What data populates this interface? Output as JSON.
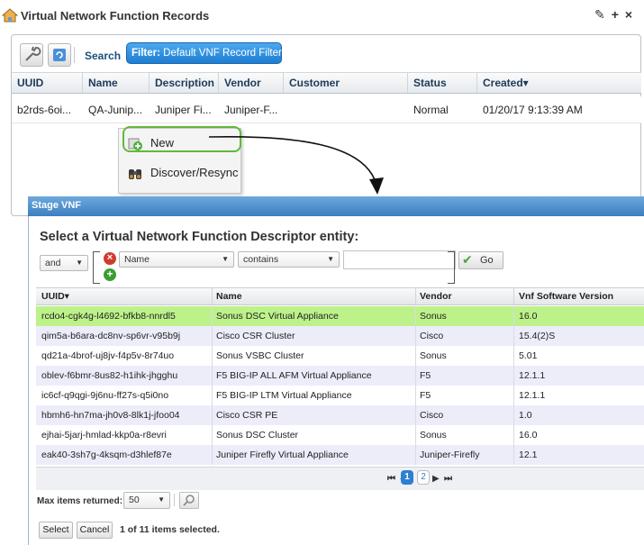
{
  "title": "Virtual Network Function Records",
  "title_actions": [
    "✎",
    "+",
    "×"
  ],
  "toolbar": {
    "search_label": "Search",
    "filter_prefix": "Filter:",
    "filter_value": "Default VNF Record Filter"
  },
  "vnf_table": {
    "columns": [
      "UUID",
      "Name",
      "Description",
      "Vendor",
      "Customer",
      "Status",
      "Created▾"
    ],
    "row": [
      "b2rds-6oi...",
      "QA-Junip...",
      "Juniper Fi...",
      "Juniper-F...",
      "",
      "Normal",
      "01/20/17 9:13:39 AM"
    ]
  },
  "context_menu": {
    "items": [
      {
        "label": "New",
        "icon": "new-icon"
      },
      {
        "label": "Discover/Resync",
        "icon": "binoculars-icon"
      }
    ]
  },
  "dialog": {
    "title": "Stage VNF",
    "heading": "Select a Virtual Network Function Descriptor entity:",
    "filter": {
      "conjunction": "and",
      "field": "Name",
      "operator": "contains",
      "value": "",
      "go_label": "Go"
    },
    "grid": {
      "columns": [
        "UUID▾",
        "Name",
        "Vendor",
        "Vnf Software Version"
      ],
      "rows": [
        [
          "rcdo4-cgk4g-l4692-bfkb8-nnrdl5",
          "Sonus DSC Virtual Appliance",
          "Sonus",
          "16.0"
        ],
        [
          "qim5a-b6ara-dc8nv-sp6vr-v95b9j",
          "Cisco CSR Cluster",
          "Cisco",
          "15.4(2)S"
        ],
        [
          "qd21a-4brof-uj8jv-f4p5v-8r74uo",
          "Sonus VSBC Cluster",
          "Sonus",
          "5.01"
        ],
        [
          "oblev-f6bmr-8us82-h1ihk-jhgghu",
          "F5 BIG-IP ALL AFM Virtual Appliance",
          "F5",
          "12.1.1"
        ],
        [
          "ic6cf-q9qgi-9j6nu-ff27s-q5i0no",
          "F5 BIG-IP LTM Virtual Appliance",
          "F5",
          "12.1.1"
        ],
        [
          "hbmh6-hn7ma-jh0v8-8lk1j-jfoo04",
          "Cisco CSR PE",
          "Cisco",
          "1.0"
        ],
        [
          "ejhai-5jarj-hmlad-kkp0a-r8evri",
          "Sonus DSC Cluster",
          "Sonus",
          "16.0"
        ],
        [
          "eak40-3sh7g-4ksqm-d3hlef87e",
          "Juniper Firefly Virtual Appliance",
          "Juniper-Firefly",
          "12.1"
        ]
      ],
      "selected_index": 0
    },
    "pager": {
      "pages": [
        "1",
        "2"
      ],
      "current": "1"
    },
    "max_items_label": "Max items returned:",
    "max_items_value": "50",
    "select_label": "Select",
    "cancel_label": "Cancel",
    "selection_status": "1 of 11 items selected."
  },
  "colors": {
    "accent": "#2f7fd0",
    "selected_row": "#bdf28a",
    "highlight": "#62b83a"
  }
}
